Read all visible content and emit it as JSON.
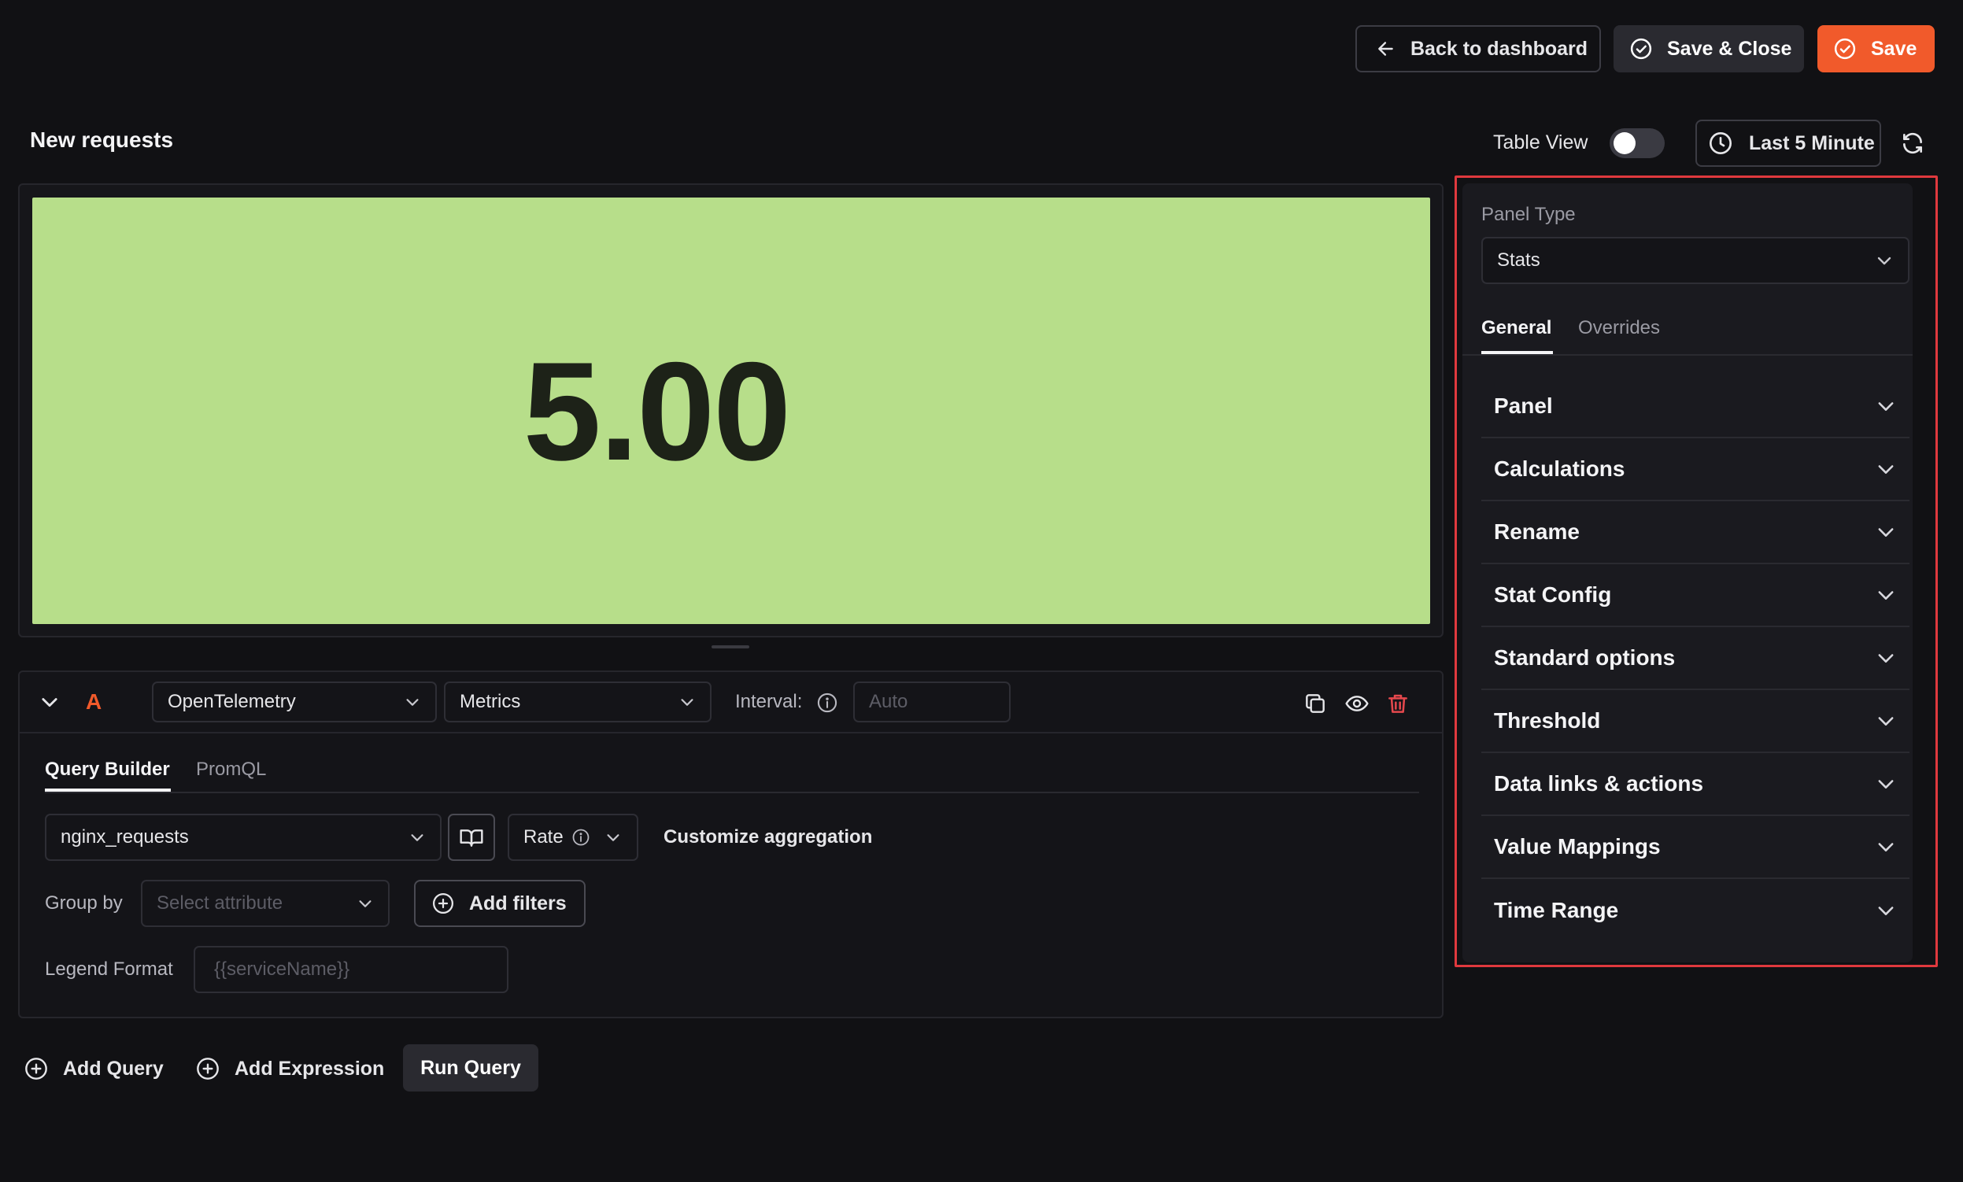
{
  "header": {
    "back_label": "Back to dashboard",
    "save_close_label": "Save & Close",
    "save_label": "Save"
  },
  "panel": {
    "title": "New requests",
    "table_view_label": "Table View",
    "table_view_on": false,
    "time_range_label": "Last 5 Minute"
  },
  "preview": {
    "value": "5.00",
    "background_color": "#b7de8a"
  },
  "query": {
    "letter": "A",
    "datasource": "OpenTelemetry",
    "signal": "Metrics",
    "interval_label": "Interval:",
    "interval_placeholder": "Auto",
    "tabs": [
      "Query Builder",
      "PromQL"
    ],
    "active_tab": "Query Builder",
    "metric": "nginx_requests",
    "aggregation": "Rate",
    "customize_label": "Customize aggregation",
    "group_by_label": "Group by",
    "group_by_placeholder": "Select attribute",
    "add_filters_label": "Add filters",
    "legend_label": "Legend Format",
    "legend_placeholder": "{{serviceName}}"
  },
  "footer": {
    "add_query_label": "Add Query",
    "add_expression_label": "Add Expression",
    "run_query_label": "Run Query"
  },
  "settings": {
    "panel_type_label": "Panel Type",
    "panel_type_value": "Stats",
    "tabs": [
      "General",
      "Overrides"
    ],
    "active_tab": "General",
    "sections": [
      "Panel",
      "Calculations",
      "Rename",
      "Stat Config",
      "Standard options",
      "Threshold",
      "Data links & actions",
      "Value Mappings",
      "Time Range"
    ]
  },
  "colors": {
    "accent": "#f15a2b",
    "highlight_border": "#e0393e",
    "danger_icon": "#e5484d"
  }
}
